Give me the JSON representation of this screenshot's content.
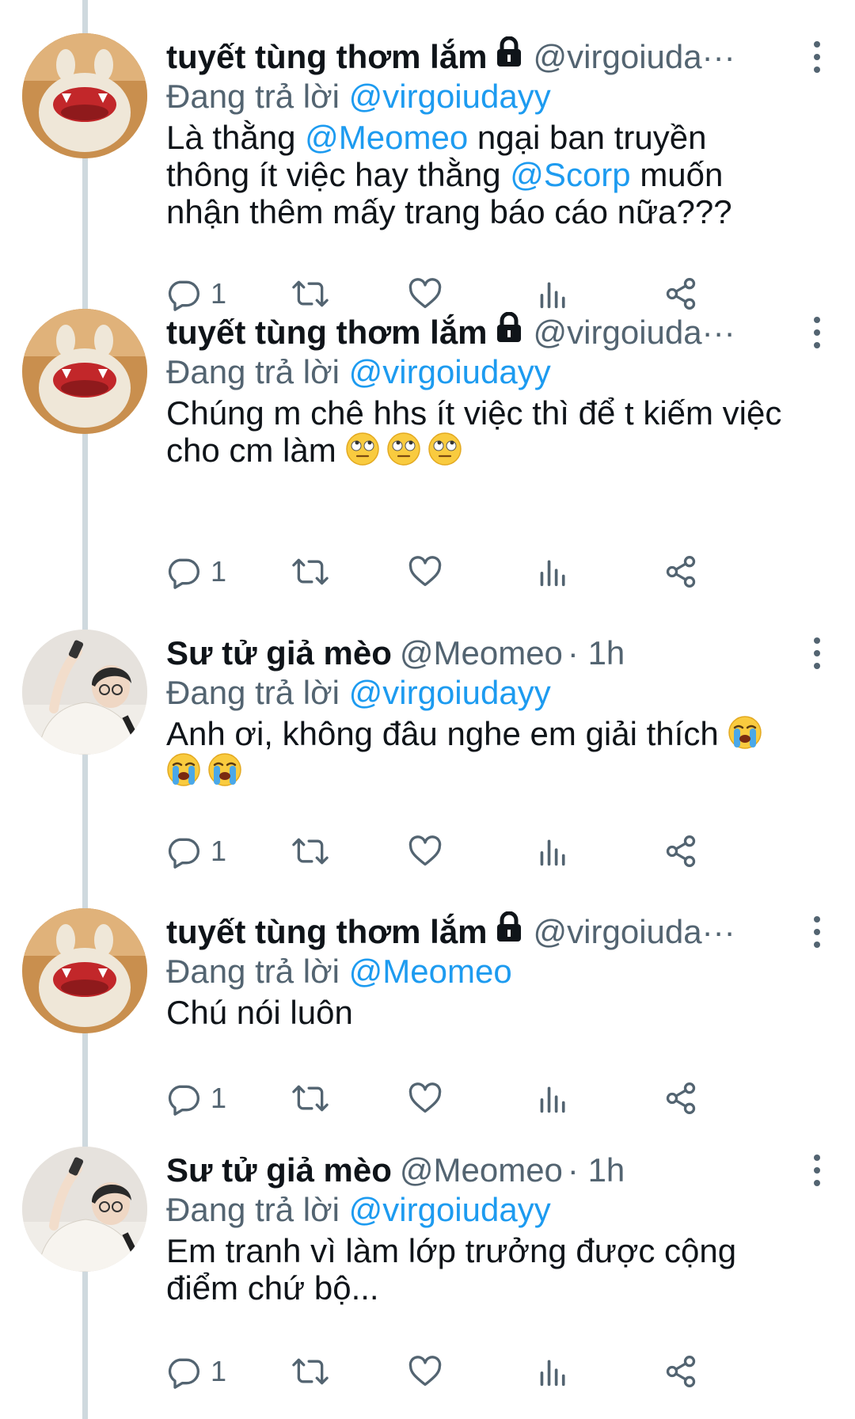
{
  "tweets": [
    {
      "name": "tuyết tùng thơm lắm",
      "locked": true,
      "handle": "@virgoiuda···",
      "time": "",
      "reply_prefix": "Đang trả lời",
      "reply_to": "@virgoiudayy",
      "body_lines": [
        [
          "Là thằng ",
          "@Meomeo",
          " ngại ban truyền"
        ],
        [
          "thông ít việc hay thằng ",
          "@Scorp",
          " muốn"
        ],
        [
          "nhận thêm mấy trang báo cáo nữa???"
        ]
      ],
      "reply_count": "1",
      "avatar": "plush-monster-icon"
    },
    {
      "name": "tuyết tùng thơm lắm",
      "locked": true,
      "handle": "@virgoiuda···",
      "time": "",
      "reply_prefix": "Đang trả lời",
      "reply_to": "@virgoiudayy",
      "body_text_1": "Chúng m chê hhs ít việc thì để t kiếm việc",
      "body_text_2": "cho cm làm",
      "emojis": [
        "eye-roll-emoji",
        "eye-roll-emoji",
        "eye-roll-emoji"
      ],
      "reply_count": "1",
      "avatar": "plush-monster-icon"
    },
    {
      "name": "Sư tử giả mèo",
      "locked": false,
      "handle": "@Meomeo",
      "time": "· 1h",
      "reply_prefix": "Đang trả lời",
      "reply_to": "@virgoiudayy",
      "body_text_1": "Anh ơi, không đâu nghe em giải thích",
      "emojis": [
        "crying-emoji",
        "crying-emoji",
        "crying-emoji"
      ],
      "reply_count": "1",
      "avatar": "person-photo-icon"
    },
    {
      "name": "tuyết tùng thơm lắm",
      "locked": true,
      "handle": "@virgoiuda···",
      "time": "",
      "reply_prefix": "Đang trả lời",
      "reply_to": "@Meomeo",
      "body_text_1": "Chú nói luôn",
      "reply_count": "1",
      "avatar": "plush-monster-icon"
    },
    {
      "name": "Sư tử giả mèo",
      "locked": false,
      "handle": "@Meomeo",
      "time": "· 1h",
      "reply_prefix": "Đang trả lời",
      "reply_to": "@virgoiudayy",
      "body_text_1": "Em tranh vì làm lớp trưởng được cộng",
      "body_text_2": "điểm chứ bộ...",
      "reply_count": "1",
      "avatar": "person-photo-icon"
    }
  ],
  "colors": {
    "text": "#0f1419",
    "secondary": "#536471",
    "link": "#1d9bf0",
    "thread_line": "#cfd9de"
  }
}
